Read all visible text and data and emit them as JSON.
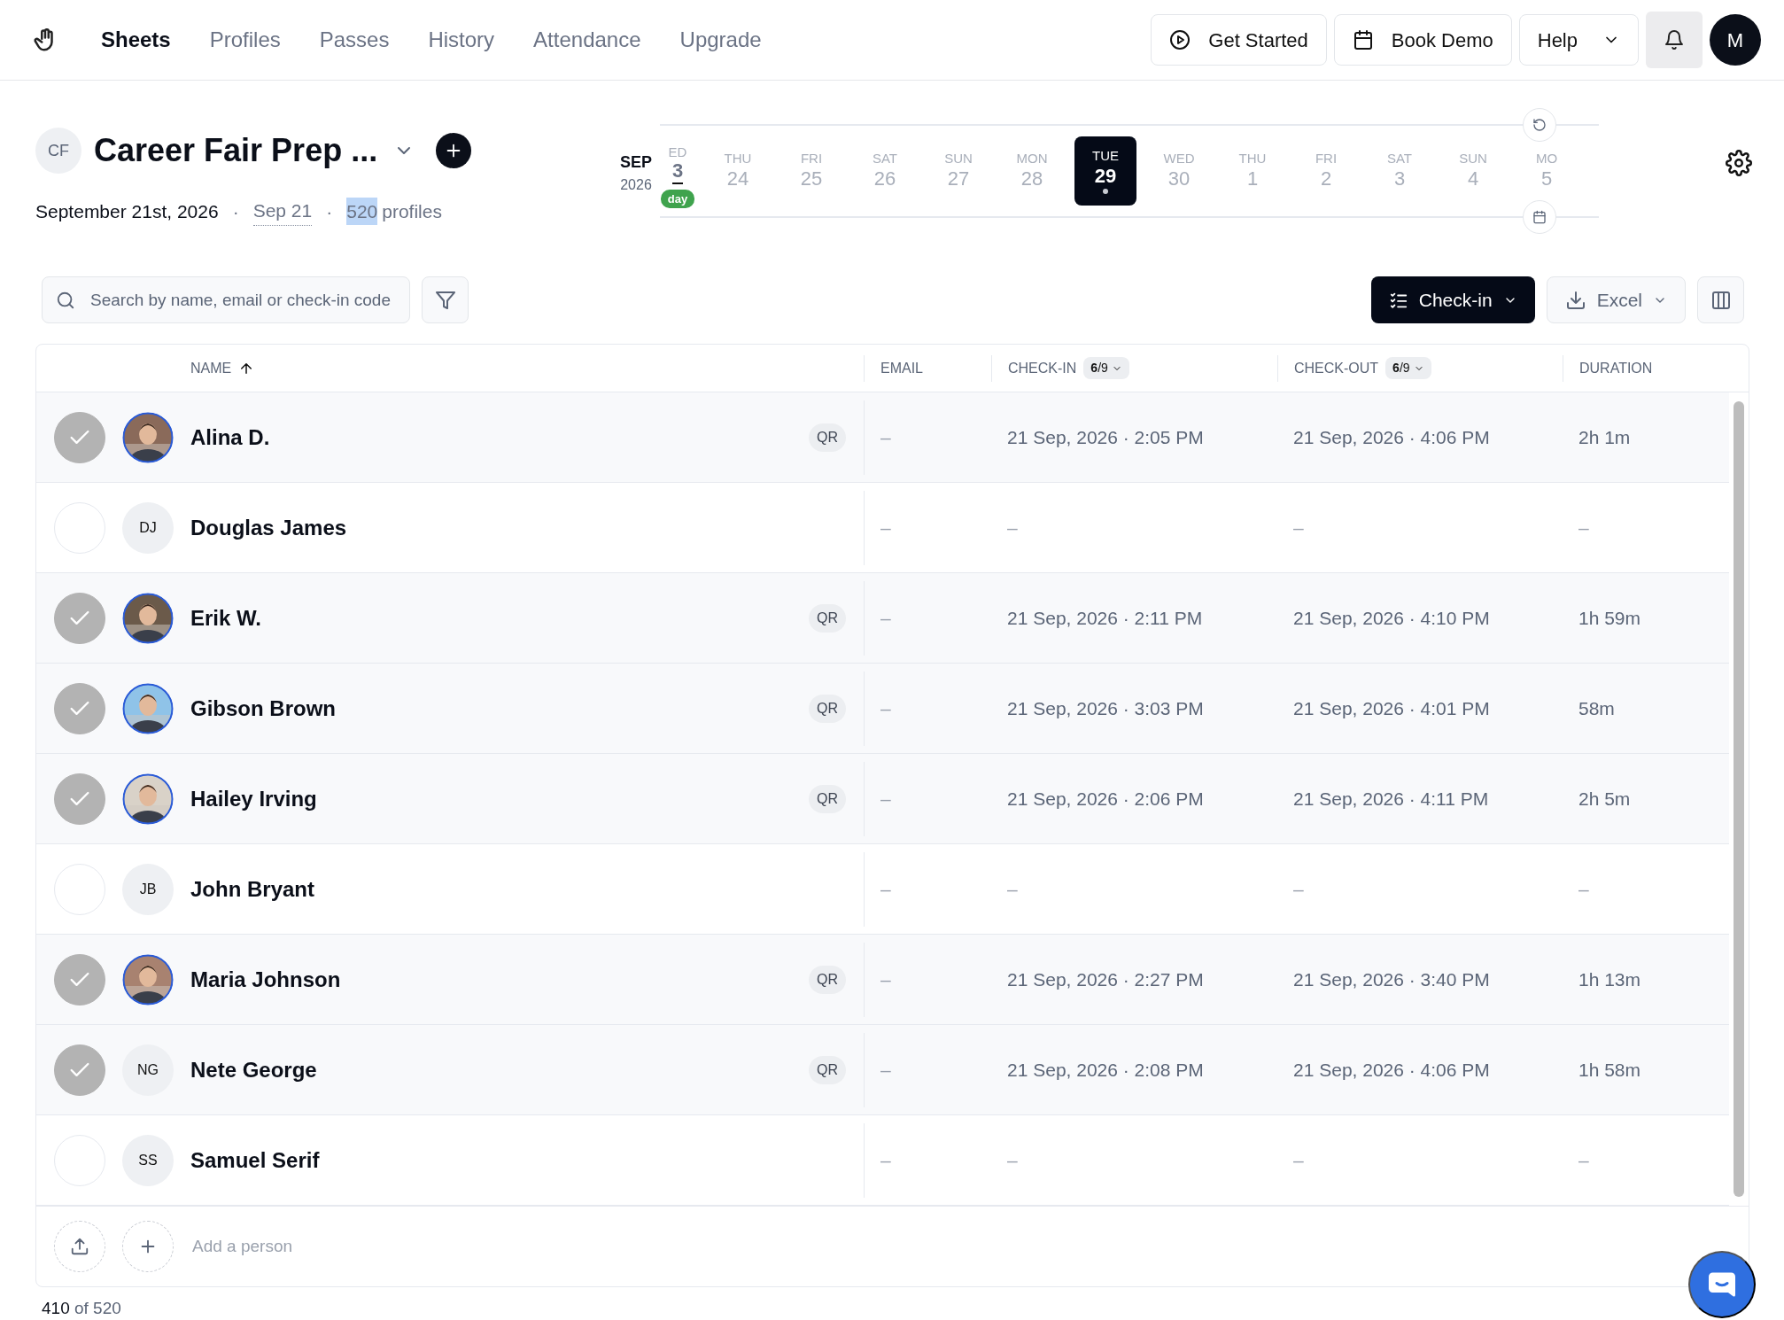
{
  "nav": {
    "items": [
      {
        "label": "Sheets",
        "selected": true
      },
      {
        "label": "Profiles",
        "selected": false
      },
      {
        "label": "Passes",
        "selected": false
      },
      {
        "label": "History",
        "selected": false
      },
      {
        "label": "Attendance",
        "selected": false
      },
      {
        "label": "Upgrade",
        "selected": false
      }
    ],
    "buttons": [
      {
        "kind": "play",
        "label": "Get Started"
      },
      {
        "kind": "calendar",
        "label": "Book Demo"
      },
      {
        "kind": "menu",
        "label": "Help"
      }
    ],
    "user_initial": "M"
  },
  "sheet": {
    "initials": "CF",
    "title": "Career Fair Prep ...",
    "date": "September 21st, 2026",
    "separator_1": "·",
    "separator_2": "·",
    "short_date": "Sep 21",
    "profiles_count": "520",
    "profiles_count_selected": true,
    "profiles_label": "profiles"
  },
  "calendar": {
    "month": "SEP",
    "year": "2026",
    "days": [
      {
        "weekday": "ED",
        "day": "3",
        "selected": false,
        "today": true,
        "today_label": "day"
      },
      {
        "weekday": "THU",
        "day": "24",
        "selected": false,
        "today": false
      },
      {
        "weekday": "FRI",
        "day": "25",
        "selected": false,
        "today": false
      },
      {
        "weekday": "SAT",
        "day": "26",
        "selected": false,
        "today": false
      },
      {
        "weekday": "SUN",
        "day": "27",
        "selected": false,
        "today": false
      },
      {
        "weekday": "MON",
        "day": "28",
        "selected": false,
        "today": false
      },
      {
        "weekday": "TUE",
        "day": "29",
        "selected": true,
        "today": false
      },
      {
        "weekday": "WED",
        "day": "30",
        "selected": false,
        "today": false
      },
      {
        "weekday": "THU",
        "day": "1",
        "selected": false,
        "today": false
      },
      {
        "weekday": "FRI",
        "day": "2",
        "selected": false,
        "today": false
      },
      {
        "weekday": "SAT",
        "day": "3",
        "selected": false,
        "today": false
      },
      {
        "weekday": "SUN",
        "day": "4",
        "selected": false,
        "today": false
      },
      {
        "weekday": "MO",
        "day": "5",
        "selected": false,
        "today": false
      }
    ]
  },
  "toolbar": {
    "search_placeholder": "Search by name, email or check-in code",
    "checkin_label": "Check-in",
    "export_label": "Excel"
  },
  "table": {
    "columns": [
      {
        "label": "NAME",
        "sorted_ascending": true
      },
      {
        "label": "EMAIL"
      },
      {
        "label": "CHECK-IN",
        "badge": "**6**/9"
      },
      {
        "label": "CHECK-OUT",
        "badge": "**6**/9"
      },
      {
        "label": "DURATION"
      }
    ],
    "rows": [
      {
        "name": "Alina D.",
        "checked": true,
        "qr": "QR",
        "email": "–",
        "check_in": "21 Sep, 2026 · 2:05 PM",
        "check_out": "21 Sep, 2026 · 4:06 PM",
        "duration": "2h 1m"
      },
      {
        "name": "Douglas James",
        "checked": false,
        "avatar": {
          "kind": "initials",
          "initials": "DJ"
        },
        "email": "–",
        "check_in": "–",
        "check_out": "–",
        "duration": "–"
      },
      {
        "name": "Erik W.",
        "checked": true,
        "qr": "QR",
        "email": "–",
        "check_in": "21 Sep, 2026 · 2:11 PM",
        "check_out": "21 Sep, 2026 · 4:10 PM",
        "duration": "1h 59m"
      },
      {
        "name": "Gibson Brown",
        "checked": true,
        "qr": "QR",
        "email": "–",
        "check_in": "21 Sep, 2026 · 3:03 PM",
        "check_out": "21 Sep, 2026 · 4:01 PM",
        "duration": "58m"
      },
      {
        "name": "Hailey Irving",
        "checked": true,
        "qr": "QR",
        "email": "–",
        "check_in": "21 Sep, 2026 · 2:06 PM",
        "check_out": "21 Sep, 2026 · 4:11 PM",
        "duration": "2h 5m"
      },
      {
        "name": "John Bryant",
        "checked": false,
        "avatar": {
          "kind": "initials",
          "initials": "JB"
        },
        "email": "–",
        "check_in": "–",
        "check_out": "–",
        "duration": "–"
      },
      {
        "name": "Maria Johnson",
        "checked": true,
        "qr": "QR",
        "email": "–",
        "check_in": "21 Sep, 2026 · 2:27 PM",
        "check_out": "21 Sep, 2026 · 3:40 PM",
        "duration": "1h 13m"
      },
      {
        "name": "Nete George",
        "checked": true,
        "avatar": {
          "kind": "initials",
          "initials": "NG"
        },
        "qr": "QR",
        "email": "–",
        "check_in": "21 Sep, 2026 · 2:08 PM",
        "check_out": "21 Sep, 2026 · 4:06 PM",
        "duration": "1h 58m"
      },
      {
        "name": "Samuel Serif",
        "checked": false,
        "avatar": {
          "kind": "initials",
          "initials": "SS"
        },
        "email": "–",
        "check_in": "–",
        "check_out": "–",
        "duration": "–"
      }
    ],
    "add_placeholder": "Add a person"
  },
  "footer": {
    "shown": "410",
    "total": "of 520"
  }
}
